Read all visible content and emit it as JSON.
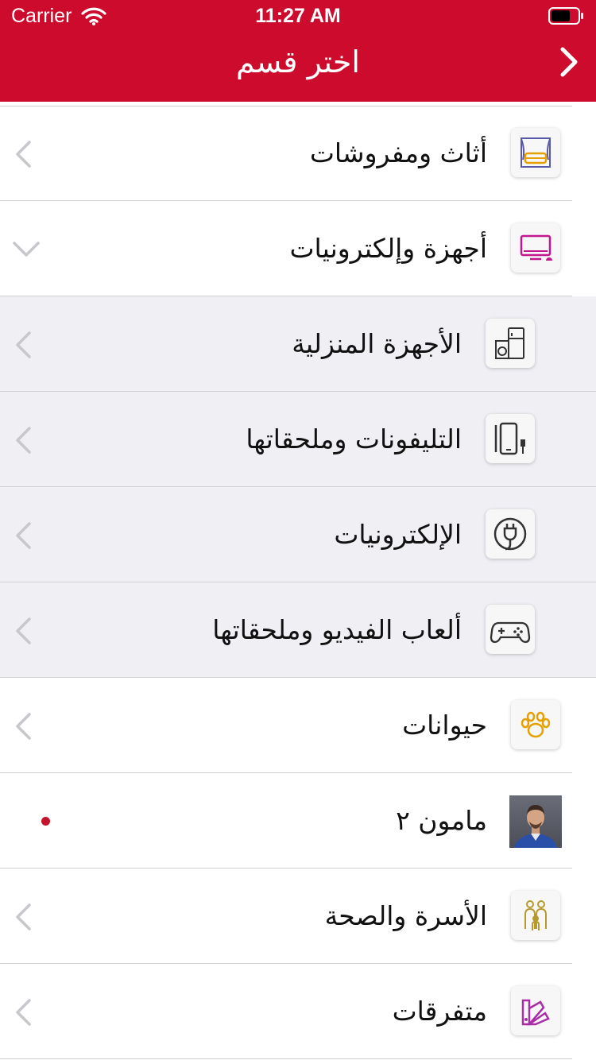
{
  "status_bar": {
    "carrier": "Carrier",
    "time": "11:27 AM"
  },
  "nav": {
    "title": "اختر قسم",
    "back_icon": "chevron-right-icon"
  },
  "colors": {
    "header": "#cc0b2d",
    "subcategory_bg": "#efeff4",
    "dot": "#c4142c"
  },
  "categories": [
    {
      "label": "أثاث ومفروشات",
      "icon": "furniture-icon",
      "indicator": "chevron-left"
    },
    {
      "label": "أجهزة وإلكترونيات",
      "icon": "monitor-icon",
      "indicator": "chevron-down",
      "expanded": true
    },
    {
      "label": "الأجهزة المنزلية",
      "icon": "home-appliances-icon",
      "indicator": "chevron-left",
      "subcategory": true
    },
    {
      "label": "التليفونات وملحقاتها",
      "icon": "phone-icon",
      "indicator": "chevron-left",
      "subcategory": true
    },
    {
      "label": "الإلكترونيات",
      "icon": "power-plug-icon",
      "indicator": "chevron-left",
      "subcategory": true
    },
    {
      "label": "ألعاب الفيديو وملحقاتها",
      "icon": "gamepad-icon",
      "indicator": "chevron-left",
      "subcategory": true
    },
    {
      "label": "حيوانات",
      "icon": "paw-icon",
      "indicator": "chevron-left"
    },
    {
      "label": "مامون ٢",
      "icon": "avatar",
      "indicator": "dot"
    },
    {
      "label": "الأسرة والصحة",
      "icon": "family-icon",
      "indicator": "chevron-left"
    },
    {
      "label": "متفرقات",
      "icon": "color-swatch-icon",
      "indicator": "chevron-left"
    }
  ]
}
